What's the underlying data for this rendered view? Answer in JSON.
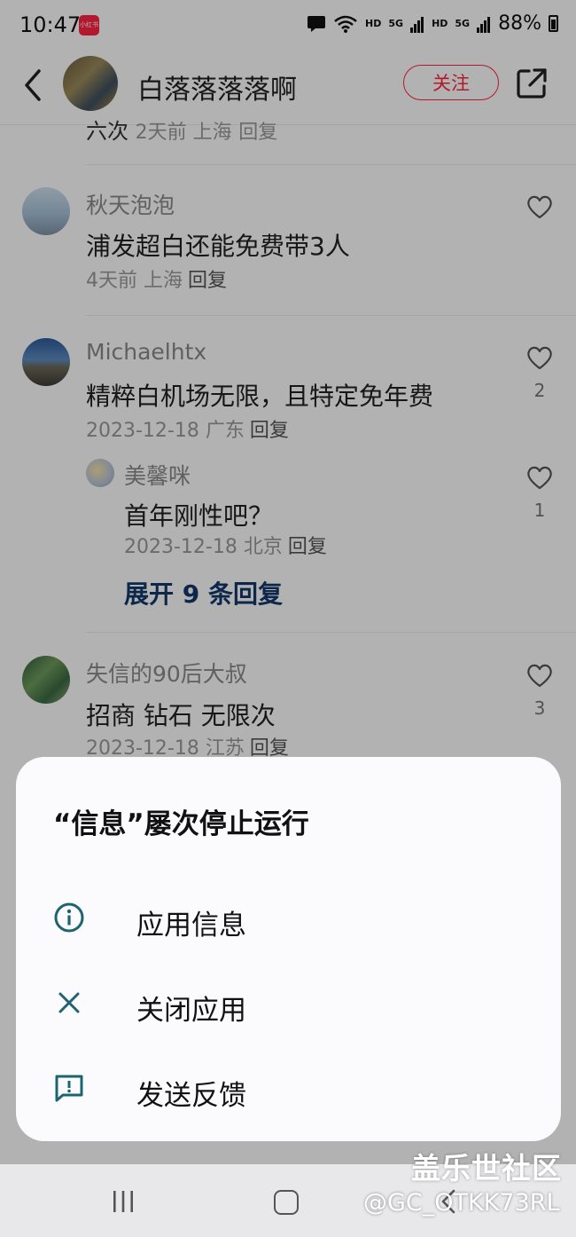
{
  "status_bar": {
    "time": "10:47",
    "app_icon_text": "小红书",
    "hd1": "HD",
    "g1": "5G",
    "hd2": "HD",
    "g2": "5G",
    "battery": "88%"
  },
  "header": {
    "username": "白落落落落啊",
    "follow_label": "关注"
  },
  "comments": {
    "cut_row": {
      "text": "六次",
      "meta": "2天前 上海",
      "reply": "回复"
    },
    "items": [
      {
        "user": "秋天泡泡",
        "text": "浦发超白还能免费带3人",
        "meta": "4天前 上海",
        "reply": "回复",
        "likes": ""
      },
      {
        "user": "Michaelhtx",
        "text": "精粹白机场无限，且特定免年费",
        "meta": "2023-12-18 广东",
        "reply": "回复",
        "likes": "2"
      },
      {
        "user": "美馨咪",
        "text": "首年刚性吧？",
        "meta": "2023-12-18 北京",
        "reply": "回复",
        "likes": "1"
      },
      {
        "user": "失信的90后大叔",
        "text": "招商 钻石 无限次",
        "meta": "2023-12-18 江苏",
        "reply": "回复",
        "likes": "3"
      }
    ],
    "expand_label": "展开 9 条回复"
  },
  "dialog": {
    "title": "“信息”屡次停止运行",
    "items": [
      {
        "label": "应用信息",
        "icon": "info-icon"
      },
      {
        "label": "关闭应用",
        "icon": "close-icon"
      },
      {
        "label": "发送反馈",
        "icon": "feedback-icon"
      }
    ]
  },
  "watermark": {
    "line1": "盖乐世社区",
    "line2": "@GC_OTKK73RL"
  }
}
